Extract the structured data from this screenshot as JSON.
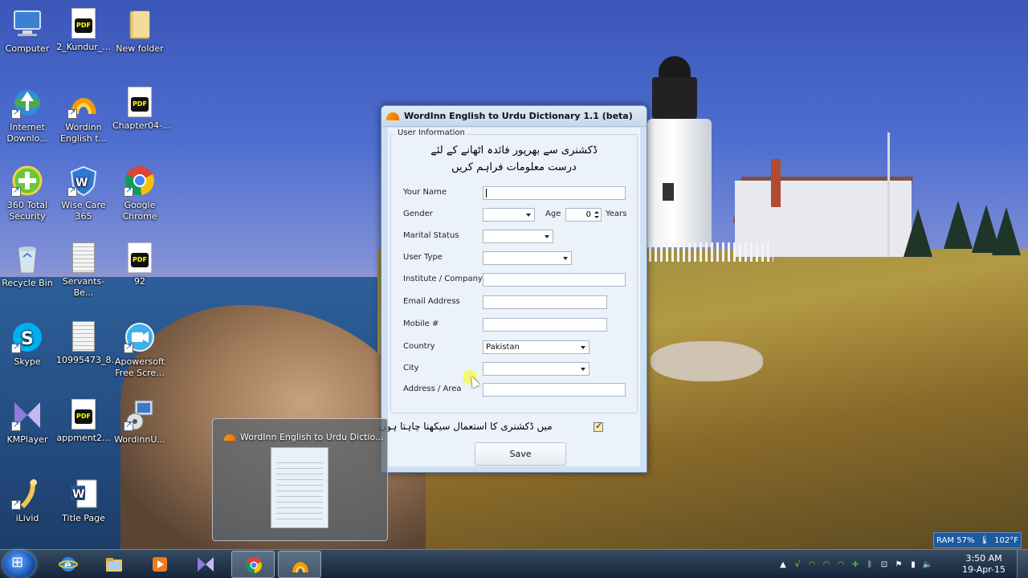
{
  "desktop": {
    "icons": [
      {
        "label": "Computer",
        "icon": "computer-icon"
      },
      {
        "label": "2_Kundur_...",
        "icon": "pdf-icon"
      },
      {
        "label": "New folder",
        "icon": "folder-icon"
      },
      {
        "label": "Internet Downlo...",
        "icon": "idm-icon"
      },
      {
        "label": "Wordinn English t...",
        "icon": "wordinn-icon"
      },
      {
        "label": "Chapter04-...",
        "icon": "pdf-icon"
      },
      {
        "label": "360 Total Security",
        "icon": "360-security-icon"
      },
      {
        "label": "Wise Care 365",
        "icon": "wise-care-icon"
      },
      {
        "label": "Google Chrome",
        "icon": "chrome-icon"
      },
      {
        "label": "Recycle Bin",
        "icon": "recycle-bin-icon"
      },
      {
        "label": "Servants-Be...",
        "icon": "document-icon"
      },
      {
        "label": "92",
        "icon": "pdf-icon"
      },
      {
        "label": "Skype",
        "icon": "skype-icon"
      },
      {
        "label": "10995473_8...",
        "icon": "document-icon"
      },
      {
        "label": "Apowersoft Free Scre...",
        "icon": "apowersoft-icon"
      },
      {
        "label": "KMPlayer",
        "icon": "kmplayer-icon"
      },
      {
        "label": "appment2...",
        "icon": "pdf-icon"
      },
      {
        "label": "WordinnU...",
        "icon": "installer-icon"
      },
      {
        "label": "iLivid",
        "icon": "ilivid-icon"
      },
      {
        "label": "Title Page",
        "icon": "word-doc-icon"
      }
    ]
  },
  "window": {
    "title": "WordInn English to Urdu Dictionary 1.1 (beta)",
    "group_title": "User Information",
    "urdu_line1": "ڈکشنری سے بھرپور فائدہ اٹھانے کے لئے",
    "urdu_line2": "درست معلومات فراہم کریں",
    "labels": {
      "name": "Your Name",
      "gender": "Gender",
      "age": "Age",
      "years": "Years",
      "marital": "Marital Status",
      "user_type": "User Type",
      "institute": "Institute / Company",
      "email": "Email Address",
      "mobile": "Mobile #",
      "country": "Country",
      "city": "City",
      "address": "Address / Area"
    },
    "values": {
      "name": "",
      "gender": "",
      "age": "0",
      "marital": "",
      "user_type": "",
      "institute": "",
      "email": "",
      "mobile": "",
      "country": "Pakistan",
      "city": "",
      "address": ""
    },
    "checkbox_label": "میں ڈکشنری کا استعمال سیکھنا چاہتا ہوں",
    "checkbox_checked": true,
    "save_label": "Save"
  },
  "thumbnail": {
    "title": "WordInn English to Urdu Dictio..."
  },
  "gadget": {
    "ram": "RAM 57%",
    "temp": "102°F"
  },
  "taskbar": {
    "apps": [
      {
        "name": "ie-icon"
      },
      {
        "name": "explorer-icon"
      },
      {
        "name": "media-icon"
      },
      {
        "name": "kmplayer-icon"
      },
      {
        "name": "chrome-icon"
      },
      {
        "name": "wordinn-icon"
      }
    ],
    "time": "3:50 AM",
    "date": "19-Apr-15"
  },
  "colors": {
    "window_bg": "#cfe0f3",
    "client_bg": "#ecf2fa",
    "accent_orange": "#f2a100"
  }
}
